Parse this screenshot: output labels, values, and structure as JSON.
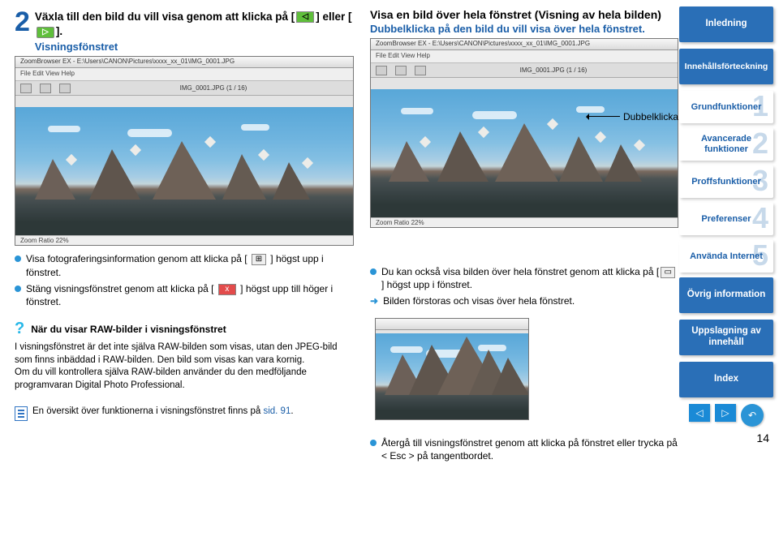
{
  "step": {
    "num": "2",
    "text": "Växla till den bild du vill visa genom att klicka på [ ◁ ] eller [ ▷ ].",
    "sub": "Visningsfönstret"
  },
  "rightHead": {
    "title": "Visa en bild över hela fönstret (Visning av hela bilden)",
    "sub": "Dubbelklicka på den bild du vill visa över hela fönstret."
  },
  "shot1": {
    "title": "ZoomBrowser EX - E:\\Users\\CANON\\Pictures\\xxxx_xx_01\\IMG_0001.JPG",
    "menu": "File   Edit   View   Help",
    "bar": "                          IMG_0001.JPG (1 / 16)",
    "zoom": "Zoom Ratio 22%"
  },
  "shot2": {
    "title": "ZoomBrowser EX - E:\\Users\\CANON\\Pictures\\xxxx_xx_01\\IMG_0001.JPG",
    "menu": "File   Edit   View   Help",
    "bar": "                          IMG_0001.JPG (1 / 16)",
    "zoom": "Zoom Ratio 22%"
  },
  "dubbel": "Dubbelklicka",
  "tipsRight": {
    "l1": "Du kan också visa bilden över hela fönstret genom att klicka på [      ] högst upp i fönstret.",
    "l2": "Bilden förstoras och visas över hela fönstret."
  },
  "tipsLeft": {
    "l1a": "Visa fotograferingsinformation genom att klicka på [",
    "l1b": "] högst upp i fönstret.",
    "l2a": "Stäng visningsfönstret genom att klicka på [",
    "l2b": "] högst upp till höger i fönstret."
  },
  "raw": {
    "title": "När du visar RAW-bilder i visningsfönstret",
    "body1": "I visningsfönstret är det inte själva RAW-bilden som visas, utan den JPEG-bild som finns inbäddad i RAW-bilden. Den bild som visas kan vara kornig.",
    "body2": "Om du vill kontrollera själva RAW-bilden använder du den medföljande programvaran Digital Photo Professional."
  },
  "footer": {
    "text": "En översikt över funktionerna i visningsfönstret finns på ",
    "link": "sid. 91"
  },
  "returnTip": "Återgå till visningsfönstret genom att klicka på fönstret eller trycka på < Esc > på tangentbordet.",
  "sidebar": {
    "intro": "Inledning",
    "toc": "Innehållsförteckning",
    "items": [
      {
        "num": "1",
        "label": "Grundfunktioner"
      },
      {
        "num": "2",
        "label": "Avancerade funktioner"
      },
      {
        "num": "3",
        "label": "Proffsfunktioner"
      },
      {
        "num": "4",
        "label": "Preferenser"
      },
      {
        "num": "5",
        "label": "Använda Internet"
      }
    ],
    "other": "Övrig information",
    "lookup": "Uppslagning av innehåll",
    "index": "Index",
    "page": "14"
  },
  "iconBack": "◁",
  "iconFwd": "▷",
  "iconX": "x",
  "iconUndo": "↶"
}
